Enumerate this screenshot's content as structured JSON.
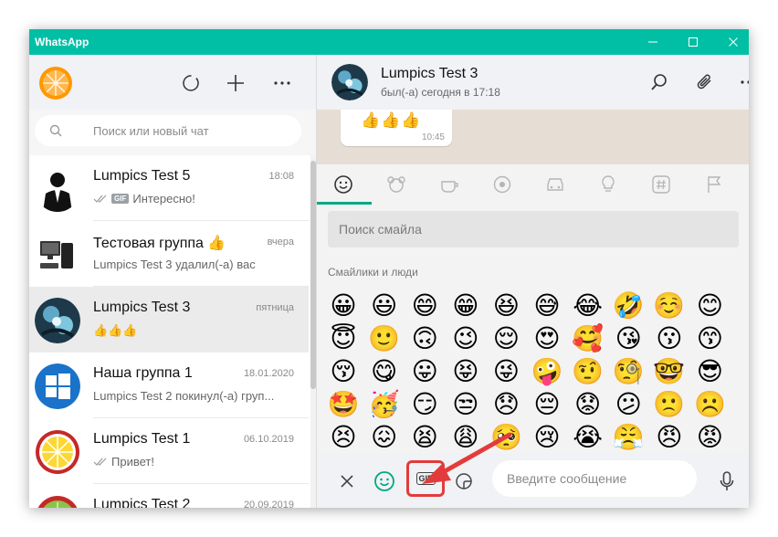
{
  "window": {
    "title": "WhatsApp",
    "accent": "#00BFA5",
    "controls": [
      "minimize-icon",
      "maximize-icon",
      "close-icon"
    ]
  },
  "sidebar": {
    "header_icons": [
      "status-icon",
      "new-chat-icon",
      "menu-icon"
    ],
    "search": {
      "placeholder": "Поиск или новый чат"
    },
    "chats": [
      {
        "name": "Lumpics Test 5",
        "time": "18:08",
        "gif": "GIF",
        "preview": "Интересно!",
        "ticks": true,
        "avatar": "person-suit"
      },
      {
        "name": "Тестовая группа 👍",
        "time": "вчера",
        "preview": "Lumpics Test 3 удалил(-а) вас",
        "ticks": false,
        "avatar": "computer"
      },
      {
        "name": "Lumpics Test 3",
        "time": "пятница",
        "preview": "👍👍👍",
        "ticks": false,
        "avatar": "art",
        "selected": true
      },
      {
        "name": "Наша группа 1",
        "time": "18.01.2020",
        "preview": "Lumpics Test 2 покинул(-а) груп...",
        "ticks": false,
        "avatar": "windows"
      },
      {
        "name": "Lumpics Test 1",
        "time": "06.10.2019",
        "preview": "Привет!",
        "ticks": true,
        "avatar": "lemon"
      },
      {
        "name": "Lumpics Test 2",
        "time": "20.09.2019",
        "preview": "",
        "ticks": false,
        "avatar": "lime"
      }
    ]
  },
  "conversation": {
    "contact_name": "Lumpics Test 3",
    "status": "был(-а) сегодня в 17:18",
    "message": {
      "text": "👍👍👍",
      "time": "10:45"
    }
  },
  "emoji_panel": {
    "search_placeholder": "Поиск смайла",
    "category_title": "Смайлики и люди",
    "tabs": [
      "smiley-tab-icon",
      "animal-tab-icon",
      "food-tab-icon",
      "activity-tab-icon",
      "travel-tab-icon",
      "objects-tab-icon",
      "symbols-tab-icon",
      "flags-tab-icon"
    ],
    "emojis": [
      "😀",
      "😃",
      "😄",
      "😁",
      "😆",
      "😅",
      "😂",
      "🤣",
      "☺️",
      "😊",
      "😇",
      "🙂",
      "🙃",
      "😉",
      "😌",
      "😍",
      "🥰",
      "😘",
      "😗",
      "😙",
      "😚",
      "😋",
      "😛",
      "😝",
      "😜",
      "🤪",
      "🤨",
      "🧐",
      "🤓",
      "😎",
      "🤩",
      "🥳",
      "😏",
      "😒",
      "😞",
      "😔",
      "😟",
      "😕",
      "🙁",
      "☹️",
      "😣",
      "😖",
      "😫",
      "😩",
      "🥺",
      "😢",
      "😭",
      "😤",
      "😠",
      "😡"
    ]
  },
  "composer": {
    "gif_label": "GIF",
    "placeholder": "Введите сообщение"
  },
  "annotation_color": "#e33b3b"
}
